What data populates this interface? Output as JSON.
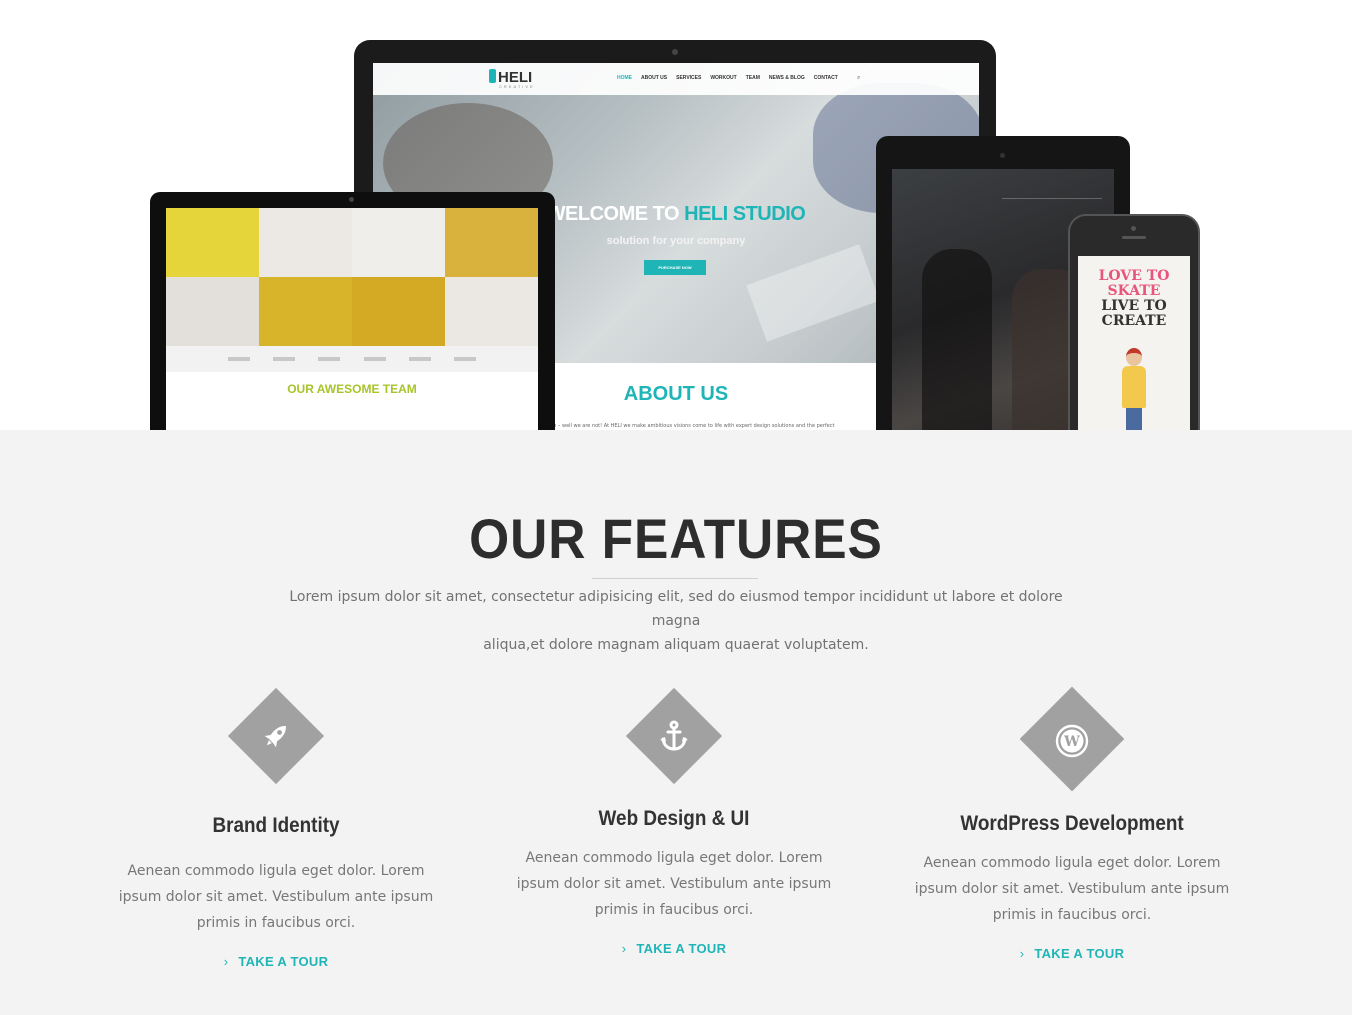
{
  "hero": {
    "imac": {
      "logo": "HELI",
      "logo_sub": "CREATIVE",
      "menu": [
        "HOME",
        "ABOUT US",
        "SERVICES",
        "WORKOUT",
        "TEAM",
        "NEWS & BLOG",
        "CONTACT"
      ],
      "welcome_prefix": "WELCOME TO ",
      "welcome_accent": "HELI STUDIO",
      "subtitle": "solution for your company",
      "button": "PURCHASE NOW",
      "about_title": "ABOUT US",
      "about_text": "...rald to dream – well we are not! At HELI we make ambitious visions come to life with expert design solutions and the perfect"
    },
    "laptop": {
      "team_title": "OUR AWESOME TEAM"
    },
    "phone": {
      "line1": "LOVE TO",
      "line2": "SKATE",
      "line3": "LIVE TO",
      "line4": "CREATE"
    }
  },
  "features": {
    "title": "OUR FEATURES",
    "intro_line1": "Lorem ipsum dolor sit amet, consectetur adipisicing elit, sed do eiusmod tempor incididunt ut labore et dolore magna",
    "intro_line2": "aliqua,et dolore magnam aliquam quaerat voluptatem.",
    "items": [
      {
        "icon": "rocket-icon",
        "title": "Brand Identity",
        "text": "Aenean commodo ligula eget dolor. Lorem ipsum dolor sit amet. Vestibulum ante ipsum primis in faucibus orci.",
        "link": "TAKE A TOUR"
      },
      {
        "icon": "anchor-icon",
        "title": "Web Design & UI",
        "text": "Aenean commodo ligula eget dolor. Lorem ipsum dolor sit amet. Vestibulum ante ipsum primis in faucibus orci.",
        "link": "TAKE A TOUR"
      },
      {
        "icon": "wordpress-icon",
        "title": "WordPress Development",
        "text": "Aenean commodo ligula eget dolor. Lorem ipsum dolor sit amet. Vestibulum ante ipsum primis in faucibus orci.",
        "link": "TAKE A TOUR"
      }
    ]
  },
  "colors": {
    "accent": "#1fb5b7",
    "icon_bg": "#a1a1a1",
    "section_bg": "#f3f3f3",
    "heading": "#2d2d2d"
  }
}
